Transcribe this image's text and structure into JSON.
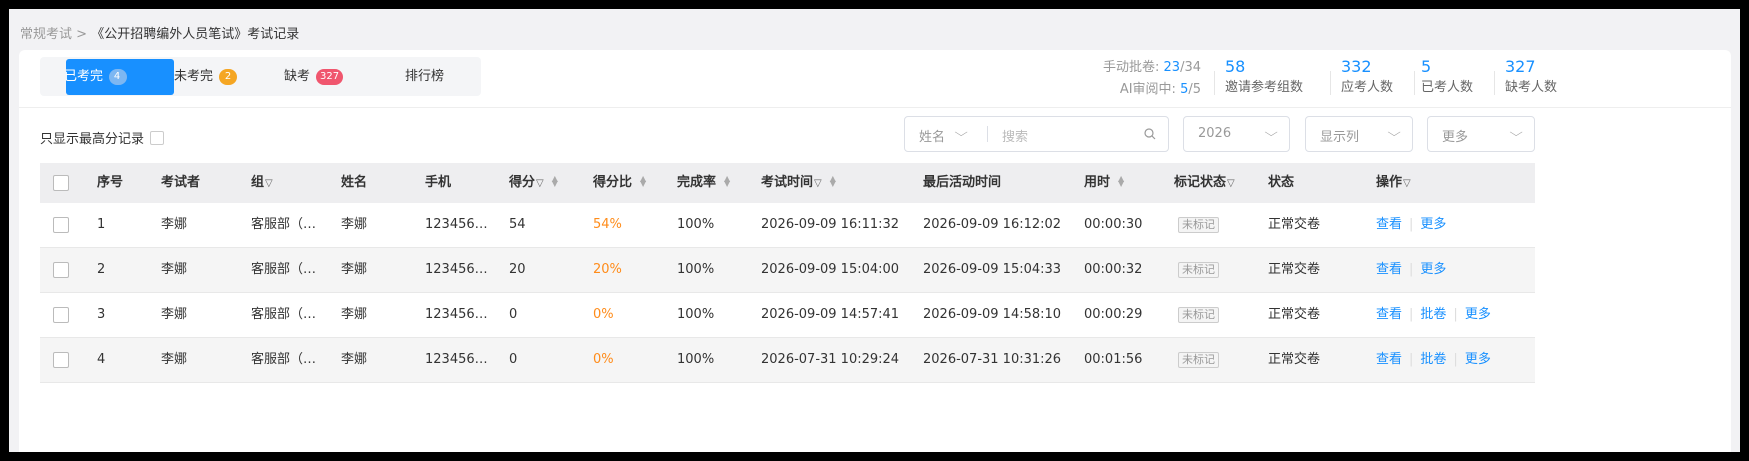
{
  "breadcrumb": {
    "parent": "常规考试",
    "separator": ">",
    "current": "《公开招聘编外人员笔试》考试记录"
  },
  "tabs": [
    {
      "label": "已考完",
      "badge": "4",
      "badge_color": "#7db7f2"
    },
    {
      "label": "未考完",
      "badge": "2",
      "badge_color": "#f5a623"
    },
    {
      "label": "缺考",
      "badge": "327",
      "badge_color": "#f0566e"
    },
    {
      "label": "排行榜",
      "badge": ""
    }
  ],
  "side": {
    "manual_label": "手动批卷:",
    "manual_done": "23",
    "manual_total": "/34",
    "ai_label": "AI审阅中:",
    "ai_done": "5",
    "ai_total": "/5"
  },
  "stats": [
    {
      "num": "58",
      "label": "邀请参考组数"
    },
    {
      "num": "332",
      "label": "应考人数"
    },
    {
      "num": "5",
      "label": "已考人数"
    },
    {
      "num": "327",
      "label": "缺考人数"
    }
  ],
  "only_max_label": "只显示最高分记录",
  "filters": {
    "name_select": "姓名",
    "search_placeholder": "搜索",
    "year": "2026",
    "columns": "显示列",
    "more": "更多"
  },
  "columns": {
    "seq": "序号",
    "examinee": "考试者",
    "group": "组",
    "name": "姓名",
    "phone": "手机",
    "score": "得分",
    "ratio": "得分比",
    "completion": "完成率",
    "exam_time": "考试时间",
    "last_active": "最后活动时间",
    "duration": "用时",
    "mark_status": "标记状态",
    "status": "状态",
    "actions": "操作"
  },
  "rows": [
    {
      "seq": "1",
      "examinee": "李娜",
      "group": "客服部（…",
      "name": "李娜",
      "phone": "123456…",
      "score": "54",
      "ratio": "54%",
      "completion": "100%",
      "exam_time": "2026-09-09 16:11:32",
      "last_active": "2026-09-09 16:12:02",
      "duration": "00:00:30",
      "mark": "未标记",
      "status": "正常交卷",
      "view": "查看",
      "review": "",
      "more": "更多"
    },
    {
      "seq": "2",
      "examinee": "李娜",
      "group": "客服部（…",
      "name": "李娜",
      "phone": "123456…",
      "score": "20",
      "ratio": "20%",
      "completion": "100%",
      "exam_time": "2026-09-09 15:04:00",
      "last_active": "2026-09-09 15:04:33",
      "duration": "00:00:32",
      "mark": "未标记",
      "status": "正常交卷",
      "view": "查看",
      "review": "",
      "more": "更多"
    },
    {
      "seq": "3",
      "examinee": "李娜",
      "group": "客服部（…",
      "name": "李娜",
      "phone": "123456…",
      "score": "0",
      "ratio": "0%",
      "completion": "100%",
      "exam_time": "2026-09-09 14:57:41",
      "last_active": "2026-09-09 14:58:10",
      "duration": "00:00:29",
      "mark": "未标记",
      "status": "正常交卷",
      "view": "查看",
      "review": "批卷",
      "more": "更多"
    },
    {
      "seq": "4",
      "examinee": "李娜",
      "group": "客服部（…",
      "name": "李娜",
      "phone": "123456…",
      "score": "0",
      "ratio": "0%",
      "completion": "100%",
      "exam_time": "2026-07-31 10:29:24",
      "last_active": "2026-07-31 10:31:26",
      "duration": "00:01:56",
      "mark": "未标记",
      "status": "正常交卷",
      "view": "查看",
      "review": "批卷",
      "more": "更多"
    }
  ]
}
